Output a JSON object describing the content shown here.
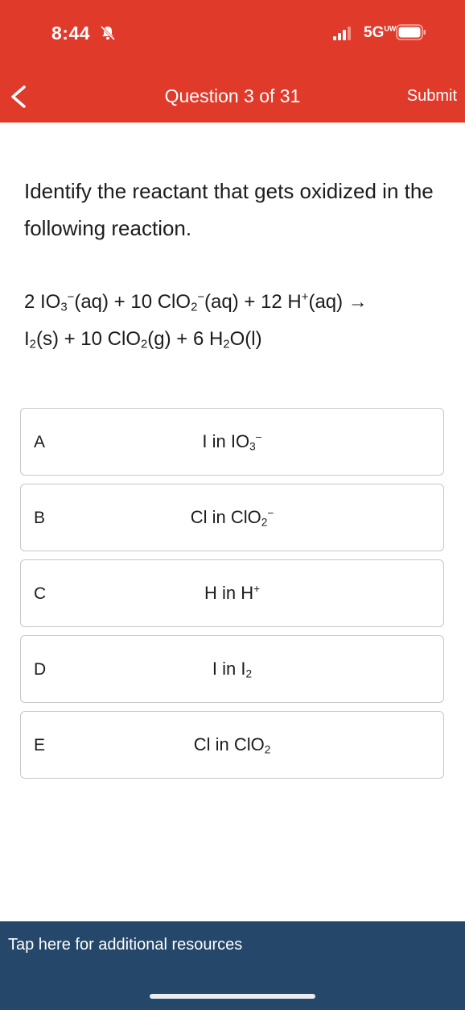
{
  "status_bar": {
    "time": "8:44",
    "network": "5G",
    "network_suffix": "UW"
  },
  "header": {
    "title": "Question 3 of 31",
    "submit_label": "Submit"
  },
  "question": {
    "prompt": "Identify the reactant that gets oxidized in the following reaction.",
    "reaction": {
      "line1": {
        "c1": "2 IO",
        "s1": "3",
        "p1": "−",
        "t1": "(aq) + 10 ClO",
        "s2": "2",
        "p2": "−",
        "t2": "(aq) + 12 H",
        "p3": "+",
        "t3": "(aq) →"
      },
      "line2": {
        "c1": "I",
        "s1": "2",
        "t1": "(s) + 10 ClO",
        "s2": "2",
        "t2": "(g) + 6 H",
        "s3": "2",
        "t3": "O(l)"
      }
    }
  },
  "choices": [
    {
      "letter": "A",
      "pre": "I in IO",
      "sub": "3",
      "sup": "−"
    },
    {
      "letter": "B",
      "pre": "Cl in ClO",
      "sub": "2",
      "sup": "−"
    },
    {
      "letter": "C",
      "pre": "H in H",
      "sub": "",
      "sup": "+"
    },
    {
      "letter": "D",
      "pre": "I in I",
      "sub": "2",
      "sup": ""
    },
    {
      "letter": "E",
      "pre": "Cl in ClO",
      "sub": "2",
      "sup": ""
    }
  ],
  "footer": {
    "resources_label": "Tap here for additional resources"
  },
  "colors": {
    "header_bg": "#e03a2b",
    "footer_bg": "#24476a",
    "choice_border": "#c7c7cc"
  },
  "icons": [
    "bell-slash-icon",
    "signal-icon",
    "battery-icon",
    "back-chevron-icon"
  ]
}
